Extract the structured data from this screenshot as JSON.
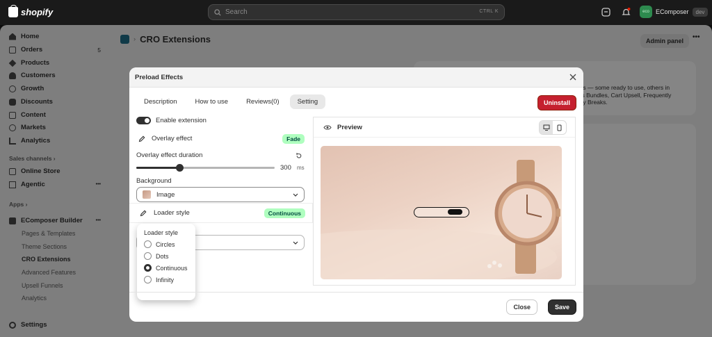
{
  "topbar": {
    "brand": "shopify",
    "search_placeholder": "Search",
    "search_shortcut": "CTRL  K",
    "store_initials": "eco",
    "store_name": "EComposer",
    "store_tag": "dev"
  },
  "sidebar": {
    "items": [
      {
        "label": "Home"
      },
      {
        "label": "Orders",
        "count": "5"
      },
      {
        "label": "Products"
      },
      {
        "label": "Customers"
      },
      {
        "label": "Growth"
      },
      {
        "label": "Discounts"
      },
      {
        "label": "Content"
      },
      {
        "label": "Markets"
      },
      {
        "label": "Analytics"
      }
    ],
    "sales_channels": "Sales channels",
    "channels": [
      {
        "label": "Online Store"
      },
      {
        "label": "Agentic"
      }
    ],
    "apps": "Apps",
    "app": "EComposer Builder",
    "app_subitems": [
      {
        "label": "Pages & Templates"
      },
      {
        "label": "Theme Sections"
      },
      {
        "label": "CRO Extensions"
      },
      {
        "label": "Advanced Features"
      },
      {
        "label": "Upsell Funnels"
      },
      {
        "label": "Analytics"
      }
    ],
    "settings": "Settings"
  },
  "main": {
    "title": "CRO Extensions",
    "admin_panel": "Admin panel",
    "bg_text_1": "ions — some ready to use, others in",
    "bg_text_2": "des Bundles, Cart Upsell, Frequently",
    "bg_text_3": "ntity Breaks."
  },
  "modal": {
    "title": "Preload Effects",
    "tabs": [
      {
        "label": "Description"
      },
      {
        "label": "How to use"
      },
      {
        "label": "Reviews(0)"
      },
      {
        "label": "Setting"
      }
    ],
    "uninstall": "Uninstall",
    "enable_label": "Enable extension",
    "overlay_label": "Overlay effect",
    "overlay_value": "Fade",
    "duration_label": "Overlay effect duration",
    "duration_value": "300",
    "duration_unit": "ms",
    "duration_fraction": 0.3,
    "background_label": "Background",
    "background_value": "Image",
    "loader_label": "Loader style",
    "loader_value": "Continuous",
    "dropdown_title": "Loader style",
    "options": [
      {
        "label": "Circles"
      },
      {
        "label": "Dots"
      },
      {
        "label": "Continuous"
      },
      {
        "label": "Infinity"
      }
    ],
    "selected_option": "Continuous",
    "preview_label": "Preview",
    "close": "Close",
    "save": "Save"
  },
  "colors": {
    "accent": "#303030",
    "badge_bg": "#affebf",
    "badge_text": "#014b40",
    "danger": "#c5202f"
  }
}
